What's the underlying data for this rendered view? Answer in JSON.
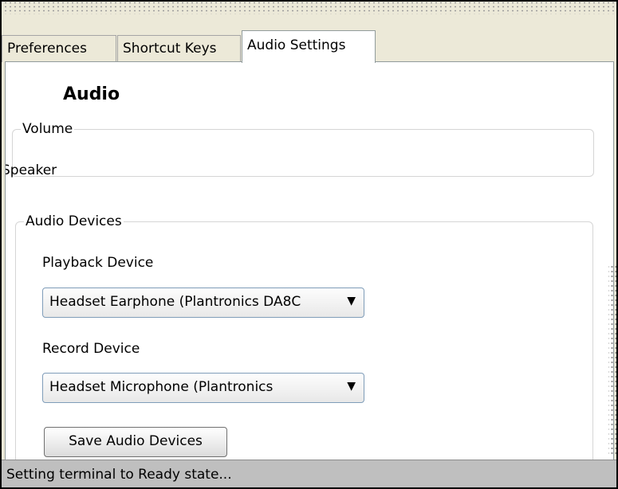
{
  "tabs": [
    {
      "label": "Preferences",
      "active": false
    },
    {
      "label": "Shortcut Keys",
      "active": false
    },
    {
      "label": "Audio Settings",
      "active": true
    }
  ],
  "audio": {
    "heading": "Audio",
    "volume_legend": "Volume",
    "speaker_label": "Speaker",
    "devices_legend": "Audio Devices",
    "playback_label": "Playback Device",
    "playback_value": "Headset Earphone (Plantronics DA8C",
    "record_label": "Record Device",
    "record_value": "Headset Microphone (Plantronics",
    "save_button": "Save Audio Devices"
  },
  "status": {
    "text": "Setting terminal to Ready state..."
  },
  "icons": {
    "dropdown_arrow": "chevron-down-icon"
  },
  "colors": {
    "panel_bg": "#ffffff",
    "window_bg": "#ece9d8",
    "status_bg": "#bfbfbf"
  }
}
